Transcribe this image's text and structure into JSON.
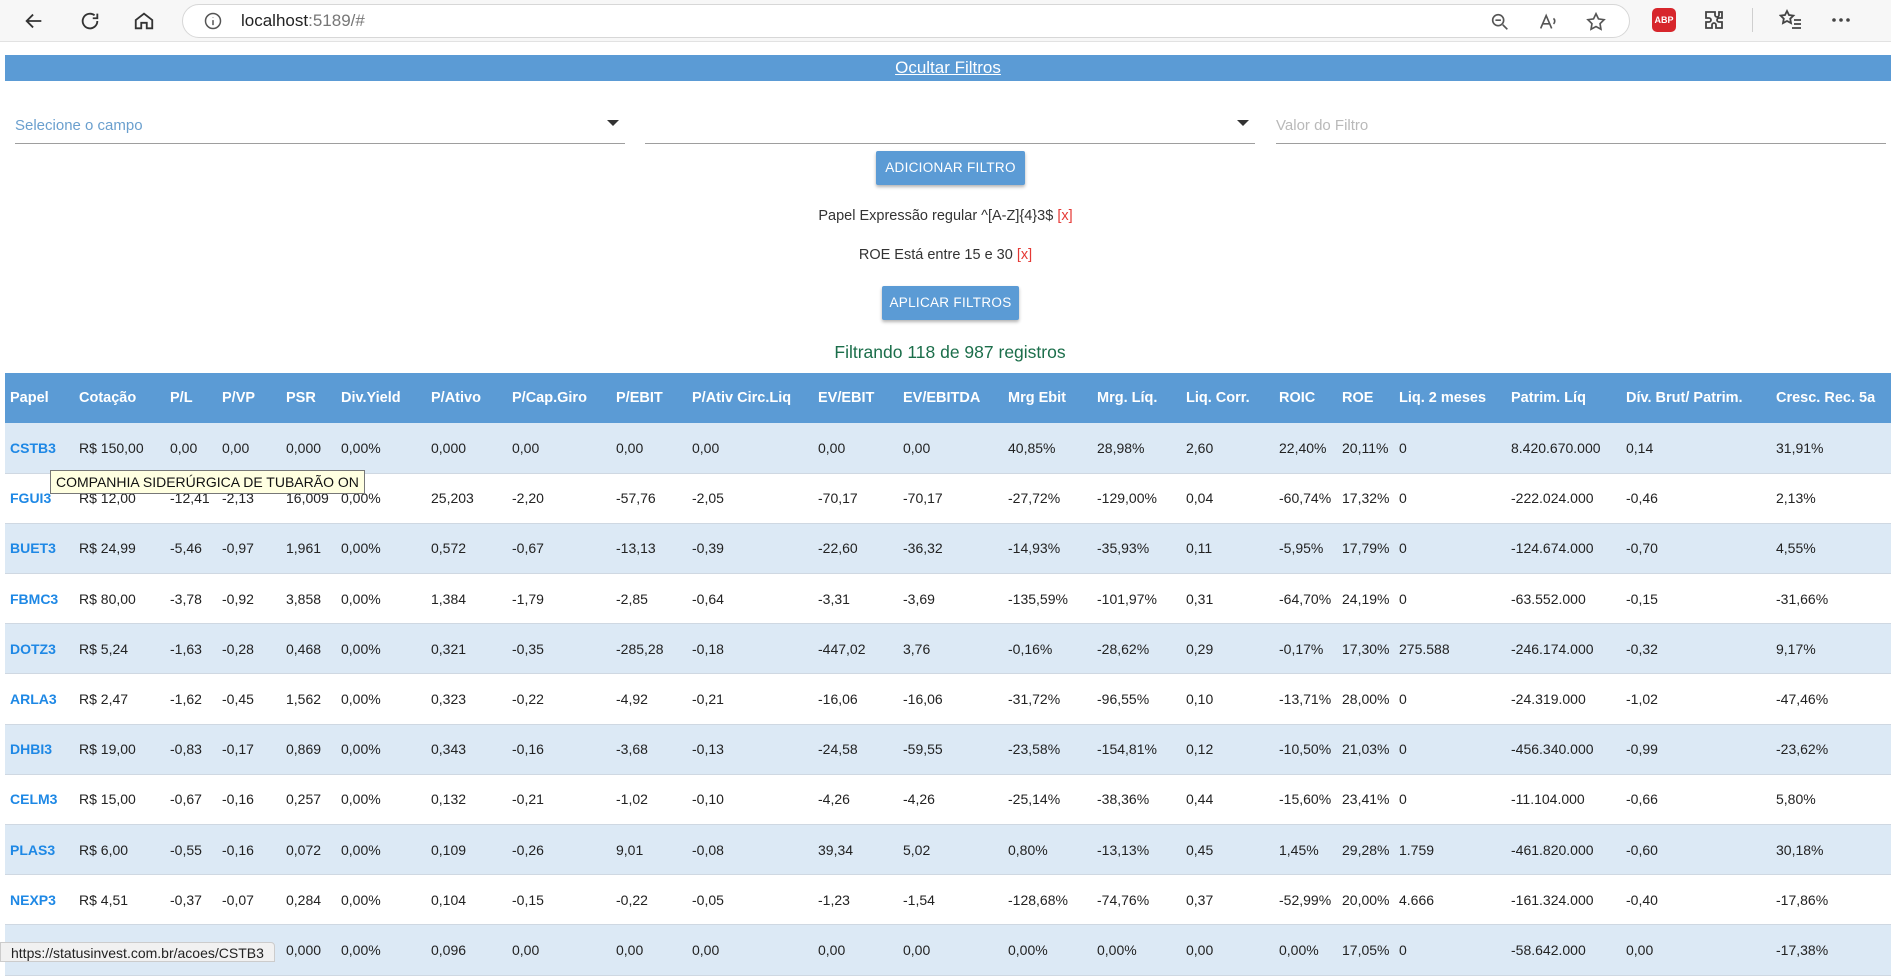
{
  "browser": {
    "url_host": "localhost",
    "url_rest": ":5189/#"
  },
  "page": {
    "toggle_label": "Ocultar Filtros",
    "field_select_placeholder": "Selecione o campo",
    "operator_select_value": "",
    "value_placeholder": "Valor do Filtro",
    "add_filter_label": "ADICIONAR FILTRO",
    "apply_filters_label": "APLICAR FILTROS",
    "filters": [
      {
        "text": "Papel Expressão regular ^[A-Z]{4}3$",
        "remove": "[x]"
      },
      {
        "text": "ROE Está entre 15 e 30",
        "remove": "[x]"
      }
    ],
    "count_text": "Filtrando 118 de 987 registros"
  },
  "table": {
    "columns": [
      "Papel",
      "Cotação",
      "P/L",
      "P/VP",
      "PSR",
      "Div.Yield",
      "P/Ativo",
      "P/Cap.Giro",
      "P/EBIT",
      "P/Ativ Circ.Liq",
      "EV/EBIT",
      "EV/EBITDA",
      "Mrg Ebit",
      "Mrg. Líq.",
      "Liq. Corr.",
      "ROIC",
      "ROE",
      "Liq. 2 meses",
      "Patrim. Líq",
      "Dív. Brut/ Patrim.",
      "Cresc. Rec. 5a"
    ],
    "rows": [
      [
        "CSTB3",
        "R$ 150,00",
        "0,00",
        "0,00",
        "0,000",
        "0,00%",
        "0,000",
        "0,00",
        "0,00",
        "0,00",
        "0,00",
        "0,00",
        "40,85%",
        "28,98%",
        "2,60",
        "22,40%",
        "20,11%",
        "0",
        "8.420.670.000",
        "0,14",
        "31,91%"
      ],
      [
        "FGUI3",
        "R$ 12,00",
        "-12,41",
        "-2,13",
        "16,009",
        "0,00%",
        "25,203",
        "-2,20",
        "-57,76",
        "-2,05",
        "-70,17",
        "-70,17",
        "-27,72%",
        "-129,00%",
        "0,04",
        "-60,74%",
        "17,32%",
        "0",
        "-222.024.000",
        "-0,46",
        "2,13%"
      ],
      [
        "BUET3",
        "R$ 24,99",
        "-5,46",
        "-0,97",
        "1,961",
        "0,00%",
        "0,572",
        "-0,67",
        "-13,13",
        "-0,39",
        "-22,60",
        "-36,32",
        "-14,93%",
        "-35,93%",
        "0,11",
        "-5,95%",
        "17,79%",
        "0",
        "-124.674.000",
        "-0,70",
        "4,55%"
      ],
      [
        "FBMC3",
        "R$ 80,00",
        "-3,78",
        "-0,92",
        "3,858",
        "0,00%",
        "1,384",
        "-1,79",
        "-2,85",
        "-0,64",
        "-3,31",
        "-3,69",
        "-135,59%",
        "-101,97%",
        "0,31",
        "-64,70%",
        "24,19%",
        "0",
        "-63.552.000",
        "-0,15",
        "-31,66%"
      ],
      [
        "DOTZ3",
        "R$ 5,24",
        "-1,63",
        "-0,28",
        "0,468",
        "0,00%",
        "0,321",
        "-0,35",
        "-285,28",
        "-0,18",
        "-447,02",
        "3,76",
        "-0,16%",
        "-28,62%",
        "0,29",
        "-0,17%",
        "17,30%",
        "275.588",
        "-246.174.000",
        "-0,32",
        "9,17%"
      ],
      [
        "ARLA3",
        "R$ 2,47",
        "-1,62",
        "-0,45",
        "1,562",
        "0,00%",
        "0,323",
        "-0,22",
        "-4,92",
        "-0,21",
        "-16,06",
        "-16,06",
        "-31,72%",
        "-96,55%",
        "0,10",
        "-13,71%",
        "28,00%",
        "0",
        "-24.319.000",
        "-1,02",
        "-47,46%"
      ],
      [
        "DHBI3",
        "R$ 19,00",
        "-0,83",
        "-0,17",
        "0,869",
        "0,00%",
        "0,343",
        "-0,16",
        "-3,68",
        "-0,13",
        "-24,58",
        "-59,55",
        "-23,58%",
        "-154,81%",
        "0,12",
        "-10,50%",
        "21,03%",
        "0",
        "-456.340.000",
        "-0,99",
        "-23,62%"
      ],
      [
        "CELM3",
        "R$ 15,00",
        "-0,67",
        "-0,16",
        "0,257",
        "0,00%",
        "0,132",
        "-0,21",
        "-1,02",
        "-0,10",
        "-4,26",
        "-4,26",
        "-25,14%",
        "-38,36%",
        "0,44",
        "-15,60%",
        "23,41%",
        "0",
        "-11.104.000",
        "-0,66",
        "5,80%"
      ],
      [
        "PLAS3",
        "R$ 6,00",
        "-0,55",
        "-0,16",
        "0,072",
        "0,00%",
        "0,109",
        "-0,26",
        "9,01",
        "-0,08",
        "39,34",
        "5,02",
        "0,80%",
        "-13,13%",
        "0,45",
        "1,45%",
        "29,28%",
        "1.759",
        "-461.820.000",
        "-0,60",
        "30,18%"
      ],
      [
        "NEXP3",
        "R$ 4,51",
        "-0,37",
        "-0,07",
        "0,284",
        "0,00%",
        "0,104",
        "-0,15",
        "-0,22",
        "-0,05",
        "-1,23",
        "-1,54",
        "-128,68%",
        "-74,76%",
        "0,37",
        "-52,99%",
        "20,00%",
        "4.666",
        "-161.324.000",
        "-0,40",
        "-17,86%"
      ],
      [
        "",
        "",
        "",
        "",
        "0,000",
        "0,00%",
        "0,096",
        "0,00",
        "0,00",
        "0,00",
        "0,00",
        "0,00",
        "0,00%",
        "0,00%",
        "0,00",
        "0,00%",
        "17,05%",
        "0",
        "-58.642.000",
        "0,00",
        "-17,38%"
      ]
    ]
  },
  "tooltip": "COMPANHIA SIDERÚRGICA DE TUBARÃO ON",
  "status_url": "https://statusinvest.com.br/acoes/CSTB3"
}
